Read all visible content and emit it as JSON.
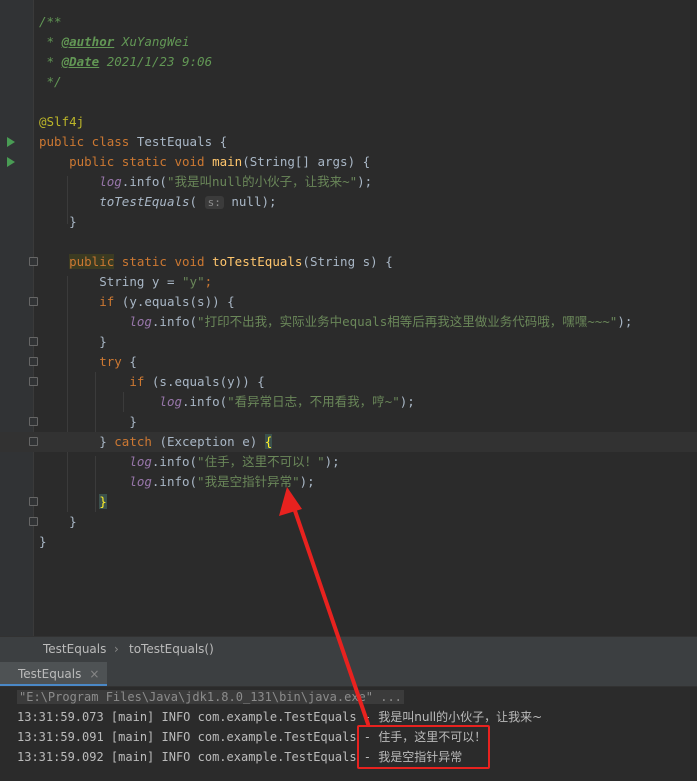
{
  "editor": {
    "javadoc_open": "/**",
    "author_tag": "@author",
    "author_name": " XuYangWei",
    "date_tag": "@Date",
    "date_value": " 2021/1/23 9:06",
    "javadoc_close": "*/",
    "annotation": "@Slf4j",
    "class_kw": "public class ",
    "class_name": "TestEquals {",
    "main_kw": "public static void ",
    "main_name": "main",
    "main_params": "(String[] args) {",
    "log": "log",
    "info": ".info(",
    "str1": "\"我是叫null的小伙子，让我来~\"",
    "call_name": "toTestEquals",
    "hint": "s:",
    "call_arg": " null);",
    "close_brace": "}",
    "method_kw_public": "public",
    "method_kw_rest": " static void ",
    "method_name": "toTestEquals",
    "method_params": "(String s) {",
    "string_type": "String y = ",
    "str_y": "\"y\"",
    "if_kw": "if ",
    "if_cond1": "(y.equals(s)) {",
    "str2": "\"打印不出我，实际业务中equals相等后再我这里做业务代码哦，嘿嘿~~~\"",
    "try_kw": "try ",
    "if_cond2": "(s.equals(y)) {",
    "str3": "\"看异常日志，不用看我，哼~\"",
    "catch_kw": "catch ",
    "catch_param": "(Exception e) ",
    "str4": "\"住手，这里不可以！\"",
    "str5": "\"我是空指针异常\"",
    "end": ");"
  },
  "breadcrumb": {
    "class": "TestEquals",
    "method": "toTestEquals()"
  },
  "console_tab": {
    "label": "TestEquals",
    "close": "×"
  },
  "console": {
    "cmd": "\"E:\\Program Files\\Java\\jdk1.8.0_131\\bin\\java.exe\" ...",
    "lines": [
      {
        "prefix": "13:31:59.073 [main] INFO com.example.TestEquals - ",
        "msg": "我是叫null的小伙子，让我来~"
      },
      {
        "prefix": "13:31:59.091 [main] INFO com.example.TestEquals - ",
        "msg": "住手，这里不可以！"
      },
      {
        "prefix": "13:31:59.092 [main] INFO com.example.TestEquals - ",
        "msg": "我是空指针异常"
      }
    ]
  },
  "colors": {
    "annotation_arrow": "#e8221f",
    "keyword": "#cc7832",
    "string": "#6a8759",
    "field": "#9876aa"
  }
}
